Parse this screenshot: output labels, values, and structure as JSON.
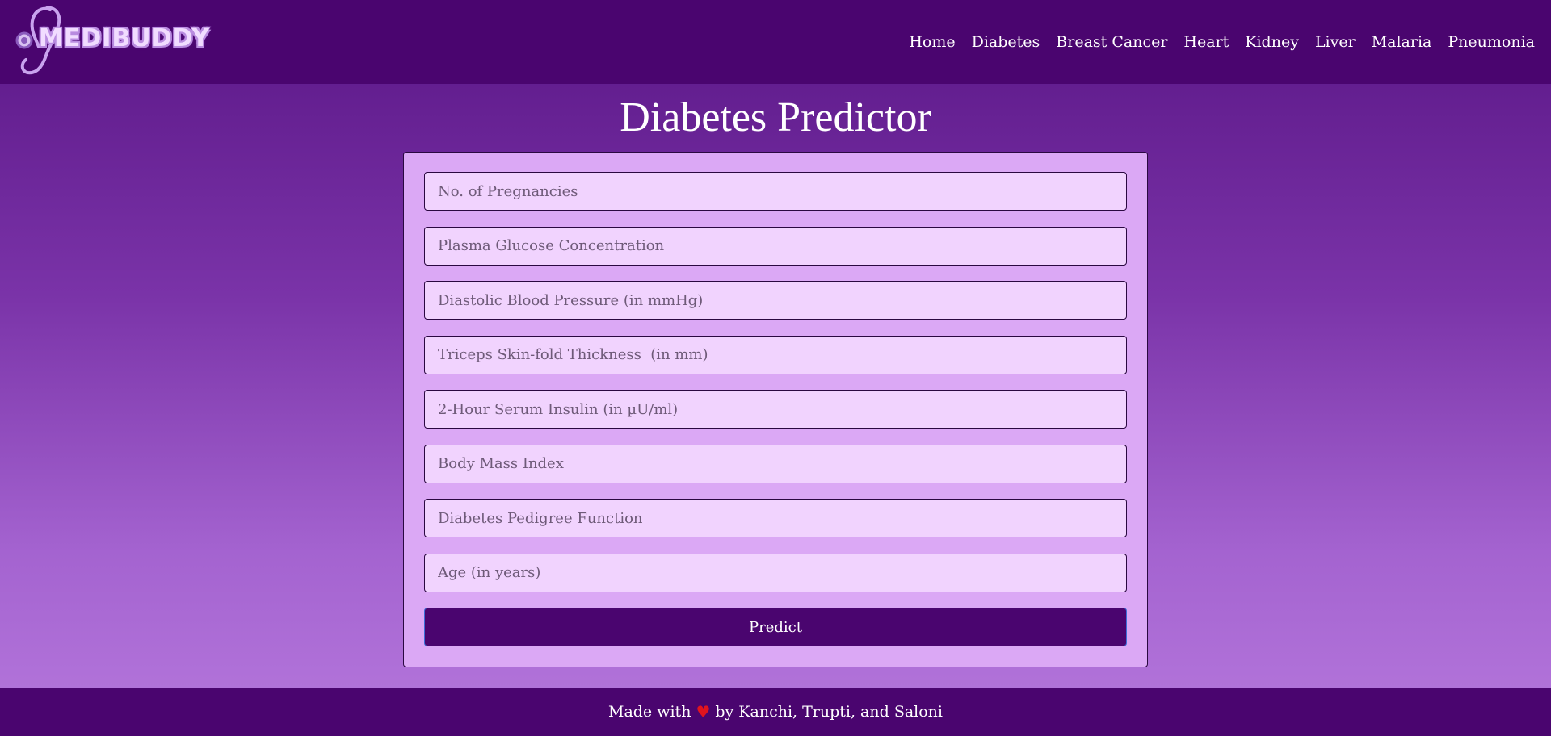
{
  "brand": {
    "name": "MEDIBUDDY",
    "logo_icon": "stethoscope-icon"
  },
  "nav": {
    "items": [
      {
        "label": "Home"
      },
      {
        "label": "Diabetes"
      },
      {
        "label": "Breast Cancer"
      },
      {
        "label": "Heart"
      },
      {
        "label": "Kidney"
      },
      {
        "label": "Liver"
      },
      {
        "label": "Malaria"
      },
      {
        "label": "Pneumonia"
      }
    ]
  },
  "page": {
    "title": "Diabetes Predictor"
  },
  "form": {
    "fields": [
      {
        "placeholder": "No. of Pregnancies",
        "value": ""
      },
      {
        "placeholder": "Plasma Glucose Concentration",
        "value": ""
      },
      {
        "placeholder": "Diastolic Blood Pressure (in mmHg)",
        "value": ""
      },
      {
        "placeholder": "Triceps Skin-fold Thickness  (in mm)",
        "value": ""
      },
      {
        "placeholder": "2-Hour Serum Insulin (in µU/ml)",
        "value": ""
      },
      {
        "placeholder": "Body Mass Index",
        "value": ""
      },
      {
        "placeholder": "Diabetes Pedigree Function",
        "value": ""
      },
      {
        "placeholder": "Age (in years)",
        "value": ""
      }
    ],
    "submit_label": "Predict"
  },
  "footer": {
    "prefix": "Made with",
    "heart_icon": "♥",
    "suffix": "by Kanchi, Trupti, and Saloni"
  },
  "colors": {
    "nav_bg": "#4a056f",
    "card_bg": "#dba8f5",
    "input_bg": "#f1d3fe",
    "button_bg": "#4a056f",
    "heart": "#e0141e"
  }
}
